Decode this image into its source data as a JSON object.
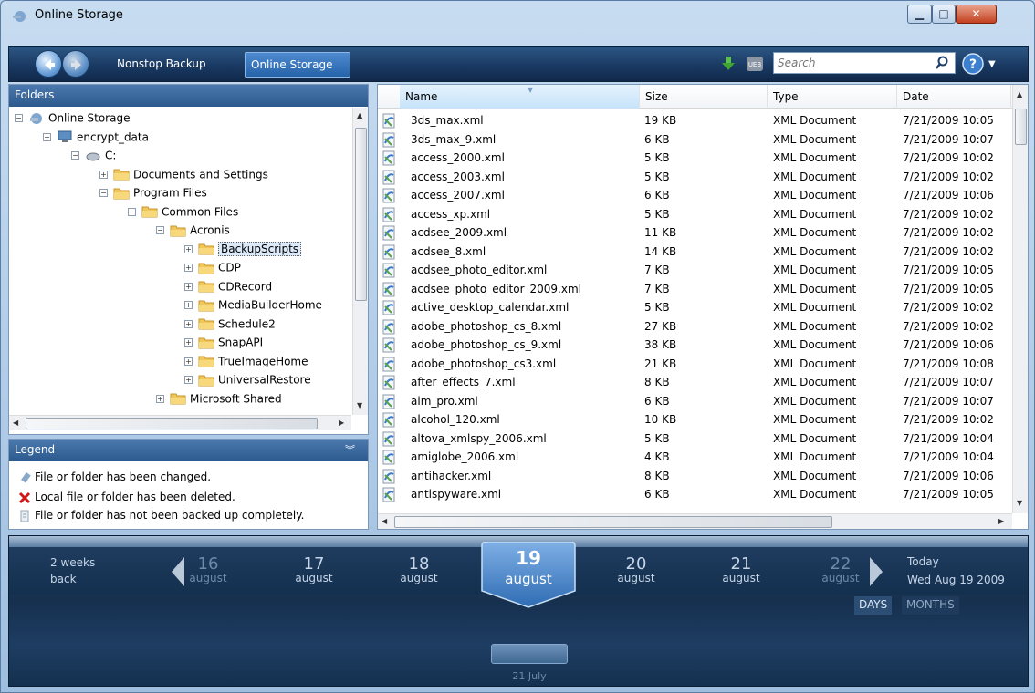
{
  "window": {
    "title": "Online Storage"
  },
  "toolbar": {
    "tabs": [
      {
        "label": "Nonstop Backup"
      },
      {
        "label": "Online Storage"
      }
    ],
    "search_placeholder": "Search"
  },
  "folders": {
    "header": "Folders",
    "tree": [
      {
        "label": "Online Storage",
        "level": 0,
        "expanded": true
      },
      {
        "label": "encrypt_data",
        "level": 1,
        "expanded": true
      },
      {
        "label": "C:",
        "level": 2,
        "expanded": true
      },
      {
        "label": "Documents and Settings",
        "level": 3,
        "expanded": false
      },
      {
        "label": "Program Files",
        "level": 3,
        "expanded": true
      },
      {
        "label": "Common Files",
        "level": 4,
        "expanded": true
      },
      {
        "label": "Acronis",
        "level": 5,
        "expanded": true
      },
      {
        "label": "BackupScripts",
        "level": 6,
        "expanded": false,
        "selected": true
      },
      {
        "label": "CDP",
        "level": 6,
        "expanded": false
      },
      {
        "label": "CDRecord",
        "level": 6,
        "expanded": false
      },
      {
        "label": "MediaBuilderHome",
        "level": 6,
        "expanded": false
      },
      {
        "label": "Schedule2",
        "level": 6,
        "expanded": false
      },
      {
        "label": "SnapAPI",
        "level": 6,
        "expanded": false
      },
      {
        "label": "TrueImageHome",
        "level": 6,
        "expanded": false
      },
      {
        "label": "UniversalRestore",
        "level": 6,
        "expanded": false
      },
      {
        "label": "Microsoft Shared",
        "level": 5,
        "expanded": false
      }
    ]
  },
  "legend": {
    "header": "Legend",
    "items": [
      {
        "icon": "changed-icon",
        "text": "File or folder has been changed."
      },
      {
        "icon": "deleted-icon",
        "text": "Local file or folder has been deleted."
      },
      {
        "icon": "incomplete-icon",
        "text": "File or folder has not been backed up completely."
      }
    ]
  },
  "file_list": {
    "columns": [
      "Name",
      "Size",
      "Type",
      "Date"
    ],
    "rows": [
      {
        "name": "3ds_max.xml",
        "size": "19 KB",
        "type": "XML Document",
        "date": "7/21/2009 10:05"
      },
      {
        "name": "3ds_max_9.xml",
        "size": "6 KB",
        "type": "XML Document",
        "date": "7/21/2009 10:07"
      },
      {
        "name": "access_2000.xml",
        "size": "5 KB",
        "type": "XML Document",
        "date": "7/21/2009 10:02"
      },
      {
        "name": "access_2003.xml",
        "size": "5 KB",
        "type": "XML Document",
        "date": "7/21/2009 10:02"
      },
      {
        "name": "access_2007.xml",
        "size": "6 KB",
        "type": "XML Document",
        "date": "7/21/2009 10:06"
      },
      {
        "name": "access_xp.xml",
        "size": "5 KB",
        "type": "XML Document",
        "date": "7/21/2009 10:02"
      },
      {
        "name": "acdsee_2009.xml",
        "size": "11 KB",
        "type": "XML Document",
        "date": "7/21/2009 10:02"
      },
      {
        "name": "acdsee_8.xml",
        "size": "14 KB",
        "type": "XML Document",
        "date": "7/21/2009 10:02"
      },
      {
        "name": "acdsee_photo_editor.xml",
        "size": "7 KB",
        "type": "XML Document",
        "date": "7/21/2009 10:05"
      },
      {
        "name": "acdsee_photo_editor_2009.xml",
        "size": "7 KB",
        "type": "XML Document",
        "date": "7/21/2009 10:05"
      },
      {
        "name": "active_desktop_calendar.xml",
        "size": "5 KB",
        "type": "XML Document",
        "date": "7/21/2009 10:02"
      },
      {
        "name": "adobe_photoshop_cs_8.xml",
        "size": "27 KB",
        "type": "XML Document",
        "date": "7/21/2009 10:02"
      },
      {
        "name": "adobe_photoshop_cs_9.xml",
        "size": "38 KB",
        "type": "XML Document",
        "date": "7/21/2009 10:06"
      },
      {
        "name": "adobe_photoshop_cs3.xml",
        "size": "21 KB",
        "type": "XML Document",
        "date": "7/21/2009 10:08"
      },
      {
        "name": "after_effects_7.xml",
        "size": "8 KB",
        "type": "XML Document",
        "date": "7/21/2009 10:07"
      },
      {
        "name": "aim_pro.xml",
        "size": "6 KB",
        "type": "XML Document",
        "date": "7/21/2009 10:07"
      },
      {
        "name": "alcohol_120.xml",
        "size": "10 KB",
        "type": "XML Document",
        "date": "7/21/2009 10:02"
      },
      {
        "name": "altova_xmlspy_2006.xml",
        "size": "5 KB",
        "type": "XML Document",
        "date": "7/21/2009 10:04"
      },
      {
        "name": "amiglobe_2006.xml",
        "size": "4 KB",
        "type": "XML Document",
        "date": "7/21/2009 10:04"
      },
      {
        "name": "antihacker.xml",
        "size": "8 KB",
        "type": "XML Document",
        "date": "7/21/2009 10:06"
      },
      {
        "name": "antispyware.xml",
        "size": "6 KB",
        "type": "XML Document",
        "date": "7/21/2009 10:05"
      }
    ]
  },
  "timeline": {
    "back_label_line1": "2 weeks",
    "back_label_line2": "back",
    "days": [
      {
        "num": "16",
        "month": "august",
        "dim": true
      },
      {
        "num": "17",
        "month": "august",
        "dim": false
      },
      {
        "num": "18",
        "month": "august",
        "dim": false
      },
      {
        "num": "19",
        "month": "august",
        "current": true
      },
      {
        "num": "20",
        "month": "august",
        "dim": false
      },
      {
        "num": "21",
        "month": "august",
        "dim": false
      },
      {
        "num": "22",
        "month": "august",
        "dim": true
      }
    ],
    "today_label": "Today",
    "today_date": "Wed Aug 19 2009",
    "toggle_days": "DAYS",
    "toggle_months": "MONTHS",
    "marker_label": "21 July"
  }
}
